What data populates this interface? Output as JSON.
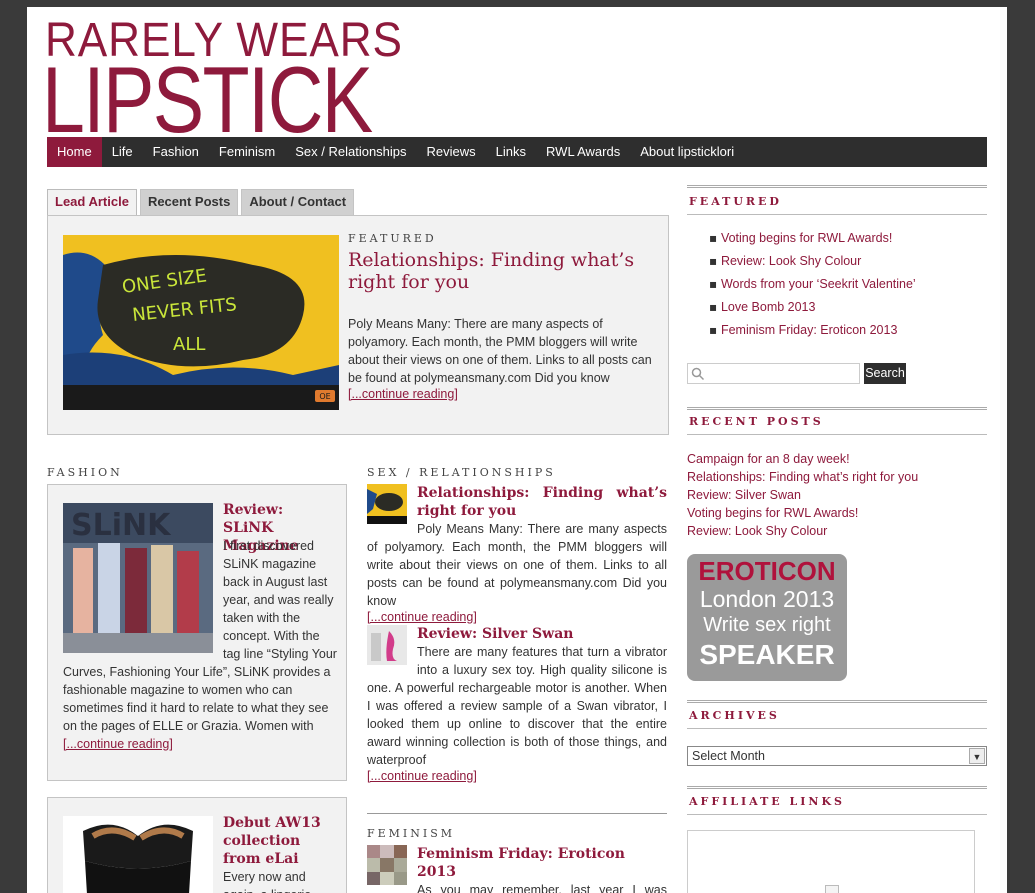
{
  "header": {
    "logo_line1": "RARELY WEARS",
    "logo_line2": "LIPSTICK"
  },
  "nav": {
    "items": [
      "Home",
      "Life",
      "Fashion",
      "Feminism",
      "Sex / Relationships",
      "Reviews",
      "Links",
      "RWL Awards",
      "About lipsticklori"
    ],
    "active": "Home"
  },
  "tabs": [
    "Lead Article",
    "Recent Posts",
    "About / Contact"
  ],
  "lead": {
    "label": "FEATURED",
    "title": "Relationships: Finding what’s right for you",
    "excerpt": "Poly Means Many: There are many aspects of polyamory. Each month, the PMM bloggers will write about their views on one of them. Links to all posts can be found at polymeansmany.com Did you know",
    "more": "[...continue reading]",
    "image_text_1": "ONE SIZE",
    "image_text_2": "NEVER FITS",
    "image_text_3": "ALL",
    "image_badge": "OE"
  },
  "fashion": {
    "label": "FASHION",
    "posts": [
      {
        "title": "Review: SLiNK Magazine",
        "excerpt": "I first discovered SLiNK magazine back in August last year, and was really taken with the concept. With the tag line “Styling Your Curves, Fashioning Your Life”, SLiNK provides a fashionable magazine to women who can sometimes find it hard to relate to what they see on the pages of ELLE or Grazia. Women with",
        "more": "[...continue reading]",
        "thumb_text": "SLiNK"
      },
      {
        "title": "Debut AW13 collection from eLai",
        "excerpt": "Every now and again, a lingerie"
      }
    ]
  },
  "sexrel": {
    "label": "SEX / RELATIONSHIPS",
    "posts": [
      {
        "title": "Relationships: Finding what’s right for you",
        "excerpt": "Poly Means Many: There are many aspects of polyamory. Each month, the PMM bloggers will write about their views on one of them. Links to all posts can be found at polymeansmany.com Did you know",
        "more": "[...continue reading]"
      },
      {
        "title": "Review: Silver Swan",
        "excerpt": "There are many features that turn a vibrator into a luxury sex toy. High quality silicone is one. A powerful rechargeable motor is another. When I was offered a review sample of a Swan vibrator, I looked them up online to discover that the entire award winning collection is both of those things, and waterproof",
        "more": "[...continue reading]"
      }
    ]
  },
  "feminism": {
    "label": "FEMINISM",
    "posts": [
      {
        "title": "Feminism Friday: Eroticon 2013",
        "excerpt": "As you may remember, last year I was invited to attend a new conference event for sex"
      }
    ]
  },
  "sidebar": {
    "featured": {
      "title": "FEATURED",
      "items": [
        "Voting begins for RWL Awards!",
        "Review: Look Shy Colour",
        "Words from your ‘Seekrit Valentine’",
        "Love Bomb 2013",
        "Feminism Friday: Eroticon 2013"
      ]
    },
    "search": {
      "placeholder": "",
      "button": "Search"
    },
    "recent": {
      "title": "RECENT POSTS",
      "items": [
        "Campaign for an 8 day week!",
        "Relationships: Finding what’s right for you",
        "Review: Silver Swan",
        "Voting begins for RWL Awards!",
        "Review: Look Shy Colour"
      ]
    },
    "badge": {
      "line1": "EROTICON",
      "line2": "London 2013",
      "line3": "Write sex right",
      "line4": "SPEAKER"
    },
    "archives": {
      "title": "ARCHIVES",
      "selected": "Select Month"
    },
    "affiliate": {
      "title": "AFFILIATE LINKS"
    }
  },
  "colors": {
    "accent": "#8e1a3c",
    "nav_bg": "#2e2e2e",
    "box_bg": "#f2f2f2",
    "frame_bg": "#3a3a3a"
  }
}
